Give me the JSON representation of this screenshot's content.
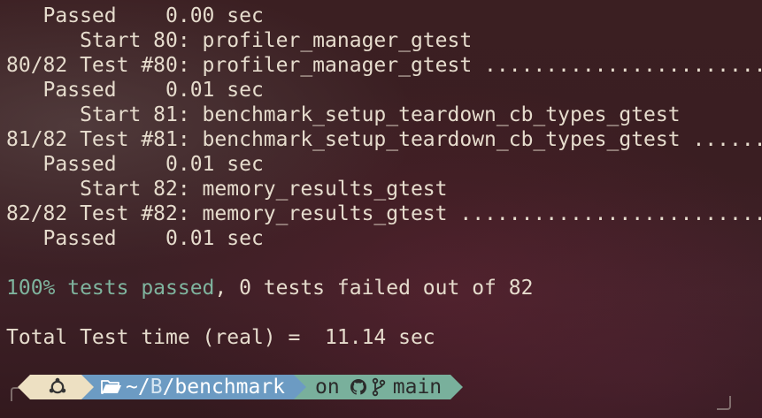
{
  "output_lines": [
    {
      "text": "   Passed    0.00 sec"
    },
    {
      "text": "      Start 80: profiler_manager_gtest"
    },
    {
      "text": "80/82 Test #80: profiler_manager_gtest ........................"
    },
    {
      "text": "   Passed    0.01 sec"
    },
    {
      "text": "      Start 81: benchmark_setup_teardown_cb_types_gtest"
    },
    {
      "text": "81/82 Test #81: benchmark_setup_teardown_cb_types_gtest ......."
    },
    {
      "text": "   Passed    0.01 sec"
    },
    {
      "text": "      Start 82: memory_results_gtest"
    },
    {
      "text": "82/82 Test #82: memory_results_gtest ........................."
    },
    {
      "text": "   Passed    0.01 sec"
    },
    {
      "text": ""
    },
    {
      "text": "",
      "highlight": "100% tests passed",
      "rest": ", 0 tests failed out of 82"
    },
    {
      "text": ""
    },
    {
      "text": "Total Test time (real) =  11.14 sec"
    }
  ],
  "prompt": {
    "os_icon": "ubuntu-icon",
    "folder_icon": "folder-open-icon",
    "path_prefix": "~/",
    "path_mid": "B",
    "path_rest": "/benchmark",
    "on_label": "on",
    "github_icon": "github-icon",
    "branch_icon": "git-branch-icon",
    "branch": "main"
  },
  "colors": {
    "background": "#3a1e22",
    "text": "#e6dccd",
    "success": "#7fb49e",
    "os_segment": "#ede0c2",
    "dir_segment": "#6c9bc3",
    "git_segment": "#79b09c"
  }
}
